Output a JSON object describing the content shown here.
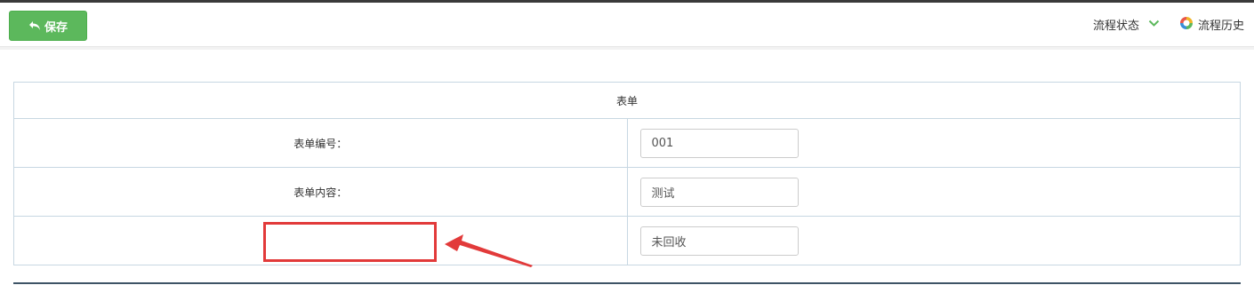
{
  "toolbar": {
    "save_label": "保存",
    "flow_status_label": "流程状态",
    "flow_history_label": "流程历史"
  },
  "form": {
    "title": "表单",
    "rows": [
      {
        "label": "表单编号：",
        "value": "001"
      },
      {
        "label": "表单内容：",
        "value": "测试"
      },
      {
        "label": "",
        "value": "未回收"
      }
    ]
  },
  "colors": {
    "save_button": "#5cb85c",
    "highlight": "#e23a3a",
    "chevron": "#5cb85c"
  },
  "icons": [
    "undo-arrow-icon",
    "chevron-down-icon",
    "ring-icon",
    "annotation-arrow"
  ]
}
